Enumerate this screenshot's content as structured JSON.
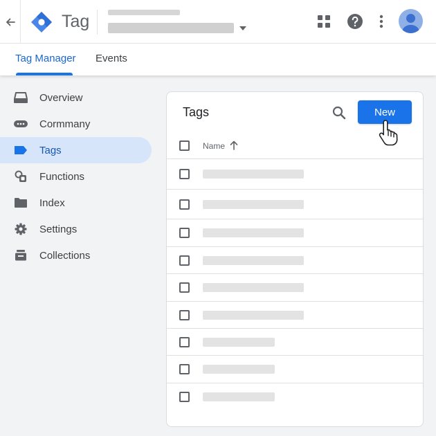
{
  "header": {
    "back_icon": "arrow-back-icon",
    "logo_icon": "tag-manager-logo",
    "app_title": "Tag",
    "account_selector_icon": "caret-down-icon",
    "icons": [
      "apps-grid-icon",
      "help-icon",
      "more-vert-icon",
      "account-avatar-icon"
    ]
  },
  "tabs": [
    {
      "label": "Tag Manager",
      "active": true
    },
    {
      "label": "Events",
      "active": false
    }
  ],
  "sidebar": {
    "items": [
      {
        "label": "Overview",
        "icon": "overview-icon",
        "active": false
      },
      {
        "label": "Cormmany",
        "icon": "company-icon",
        "active": false
      },
      {
        "label": "Tags",
        "icon": "tag-icon",
        "active": true
      },
      {
        "label": "Functions",
        "icon": "functions-icon",
        "active": false
      },
      {
        "label": "Index",
        "icon": "folder-icon",
        "active": false
      },
      {
        "label": "Settings",
        "icon": "gear-icon",
        "active": false
      },
      {
        "label": "Collections",
        "icon": "collections-icon",
        "active": false
      }
    ]
  },
  "main": {
    "card_title": "Tags",
    "search_icon": "search-icon",
    "new_button": "New",
    "cursor_icon": "hand-pointer-icon",
    "table": {
      "columns": [
        {
          "label": "Name",
          "sort": "ascending",
          "sort_icon": "arrow-up-icon"
        }
      ],
      "row_count": 9
    }
  },
  "colors": {
    "accent": "#1a73e8",
    "active_nav_bg": "#d7e5fb",
    "page_bg": "#f1f3f4"
  }
}
